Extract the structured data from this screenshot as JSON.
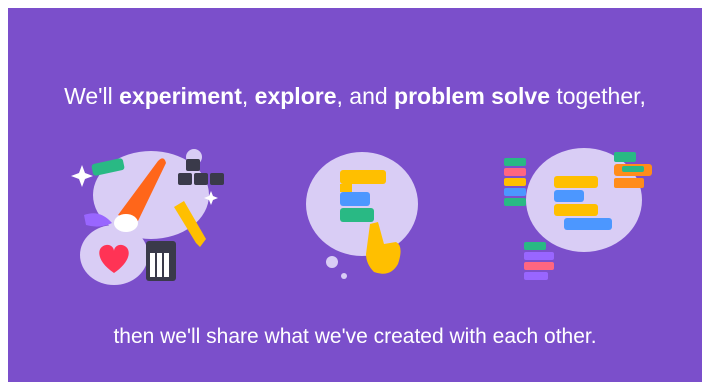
{
  "slide": {
    "headline": {
      "part1": "We'll ",
      "bold1": "experiment",
      "part2": ", ",
      "bold2": "explore",
      "part3": ", and ",
      "bold3": "problem solve",
      "part4": " together,"
    },
    "caption": "then we'll share what we've created with each other."
  },
  "colors": {
    "background": "#7b4fcb",
    "blob": "#d9cdf5",
    "block_yellow": "#ffbf00",
    "block_blue": "#4c97ff",
    "block_green": "#29b984",
    "block_pink": "#ff6680",
    "block_orange": "#ff8c1a",
    "block_purple": "#9966ff"
  },
  "illustrations": [
    {
      "name": "creative-tools",
      "icons": [
        "paintbrush-icon",
        "pencil-icon",
        "keyboard-arrows-icon",
        "heart-icon",
        "piano-icon",
        "sparkle-icon"
      ]
    },
    {
      "name": "coding-blocks",
      "icons": [
        "code-blocks-icon",
        "pointing-hand-icon"
      ]
    },
    {
      "name": "shared-blocks",
      "icons": [
        "code-blocks-icon"
      ]
    }
  ]
}
